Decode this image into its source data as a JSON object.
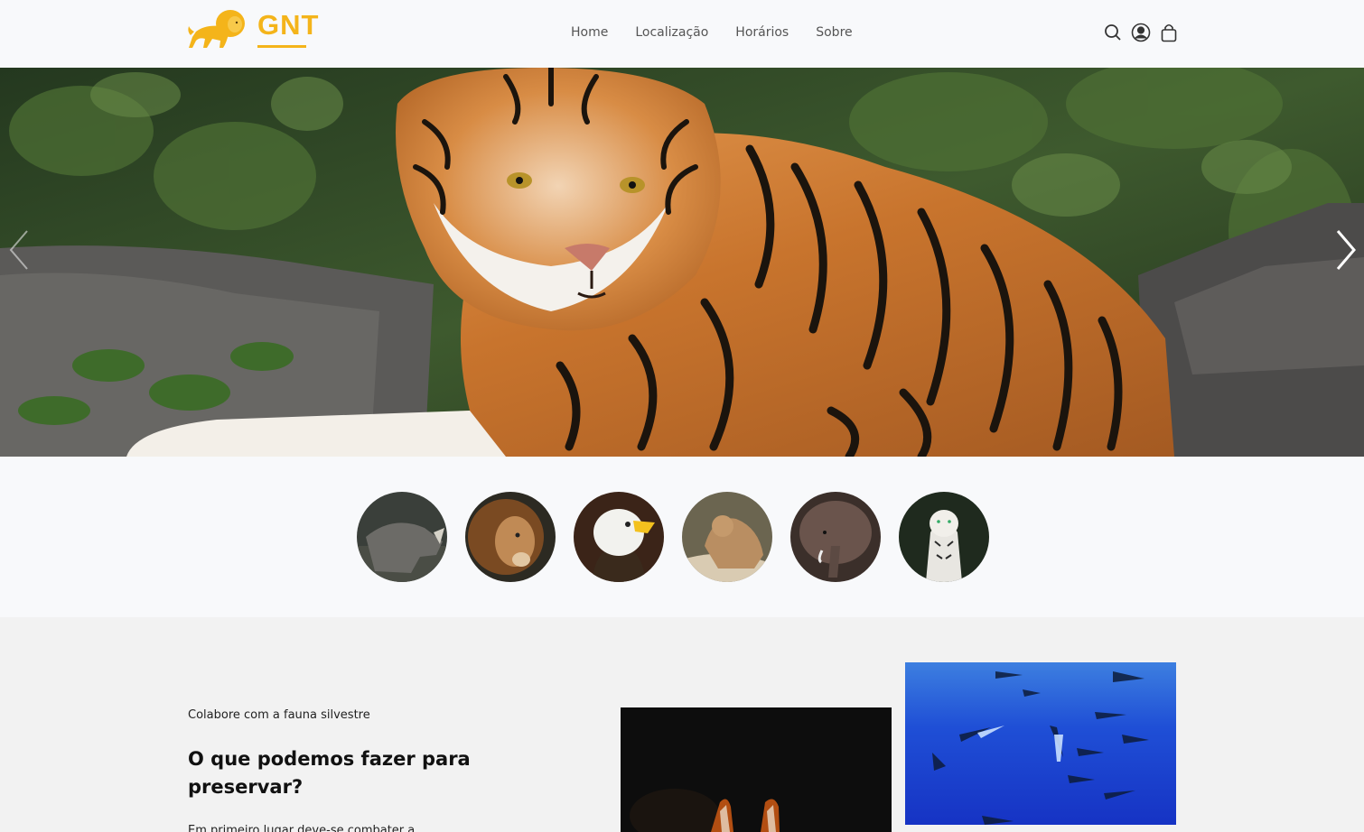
{
  "header": {
    "logo_text": "GNT",
    "nav": [
      "Home",
      "Localização",
      "Horários",
      "Sobre"
    ],
    "icons": [
      "search-icon",
      "user-icon",
      "bag-icon"
    ]
  },
  "hero": {
    "prev_icon": "chevron-left-icon",
    "next_icon": "chevron-right-icon"
  },
  "animals": [
    "rhino",
    "lion",
    "eagle",
    "puma",
    "elephant",
    "white-tiger"
  ],
  "section": {
    "eyebrow": "Colabore com a fauna silvestre",
    "title": "O que podemos fazer para preservar?",
    "body": "Em primeiro lugar deve-se combater a ilegalidade"
  },
  "colors": {
    "brand": "#f4b41a",
    "nav_text": "#555555",
    "page_bg": "#f8f9fb",
    "section_bg": "#f2f2f2"
  }
}
